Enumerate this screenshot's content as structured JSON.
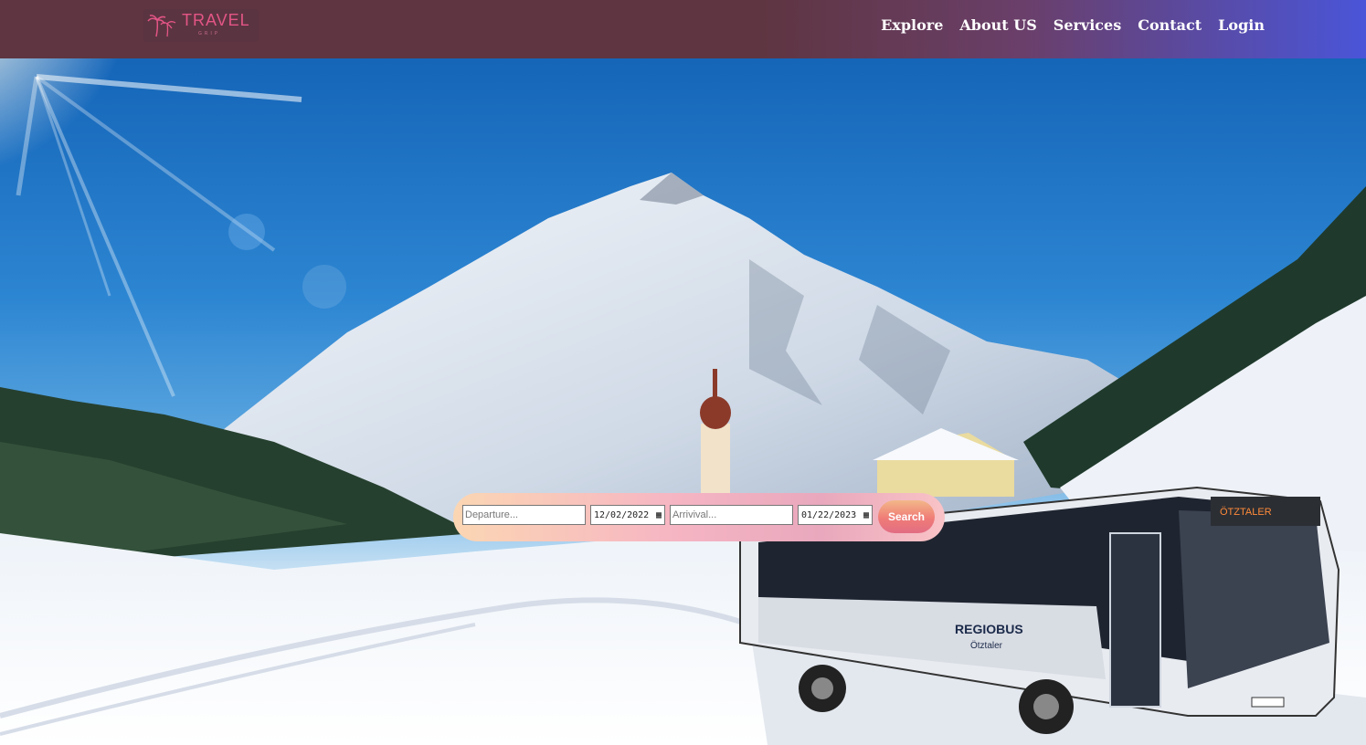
{
  "brand": {
    "logo_text": "TRAVEL",
    "logo_sub": "GRIP",
    "accent_color": "#e35586"
  },
  "nav": {
    "items": [
      {
        "label": "Explore"
      },
      {
        "label": "About US"
      },
      {
        "label": "Services"
      },
      {
        "label": "Contact"
      },
      {
        "label": "Login"
      }
    ],
    "background_colors": [
      "#5e3540",
      "#4a55d8"
    ]
  },
  "hero": {
    "scene": "snowy mountain village with a bus",
    "bus_brand": "REGIOBUS",
    "bus_sub": "Ötztaler"
  },
  "search": {
    "departure_placeholder": "Departure...",
    "departure_date": "12/02/2022",
    "arrival_placeholder": "Arrivival...",
    "arrival_date": "01/22/2023",
    "button_label": "Search"
  }
}
